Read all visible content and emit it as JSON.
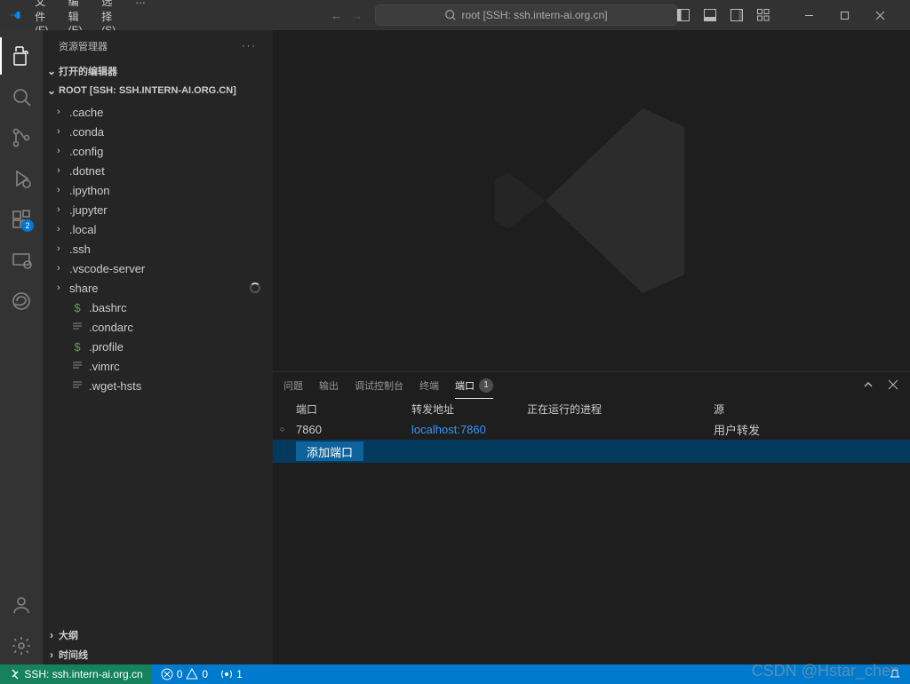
{
  "titlebar": {
    "menus": [
      "文件(F)",
      "编辑(E)",
      "选择(S)",
      "…"
    ],
    "search_label": "root [SSH: ssh.intern-ai.org.cn]"
  },
  "activity": {
    "ext_badge": "2"
  },
  "explorer": {
    "title": "资源管理器",
    "sections": {
      "open_editors": "打开的编辑器",
      "root": "ROOT [SSH: SSH.INTERN-AI.ORG.CN]",
      "outline": "大纲",
      "timeline": "时间线"
    },
    "tree": [
      {
        "type": "folder",
        "name": ".cache"
      },
      {
        "type": "folder",
        "name": ".conda"
      },
      {
        "type": "folder",
        "name": ".config"
      },
      {
        "type": "folder",
        "name": ".dotnet"
      },
      {
        "type": "folder",
        "name": ".ipython"
      },
      {
        "type": "folder",
        "name": ".jupyter"
      },
      {
        "type": "folder",
        "name": ".local"
      },
      {
        "type": "folder",
        "name": ".ssh"
      },
      {
        "type": "folder",
        "name": ".vscode-server"
      },
      {
        "type": "folder",
        "name": "share",
        "loading": true
      },
      {
        "type": "file",
        "icon": "dollar",
        "name": ".bashrc"
      },
      {
        "type": "file",
        "icon": "lines",
        "name": ".condarc"
      },
      {
        "type": "file",
        "icon": "dollar",
        "name": ".profile"
      },
      {
        "type": "file",
        "icon": "lines",
        "name": ".vimrc"
      },
      {
        "type": "file",
        "icon": "lines",
        "name": ".wget-hsts"
      }
    ]
  },
  "panel": {
    "tabs": {
      "problems": "问题",
      "output": "输出",
      "debug": "调试控制台",
      "terminal": "终端",
      "ports": "端口"
    },
    "ports_badge": "1",
    "columns": {
      "port": "端口",
      "fwd": "转发地址",
      "proc": "正在运行的进程",
      "src": "源"
    },
    "rows": [
      {
        "port": "7860",
        "fwd": "localhost:7860",
        "proc": "",
        "src": "用户转发"
      }
    ],
    "add_port": "添加端口"
  },
  "status": {
    "remote_label": "SSH: ssh.intern-ai.org.cn",
    "errors": "0",
    "warnings": "0",
    "ports": "1"
  },
  "watermark": "CSDN @Hstar_chen"
}
